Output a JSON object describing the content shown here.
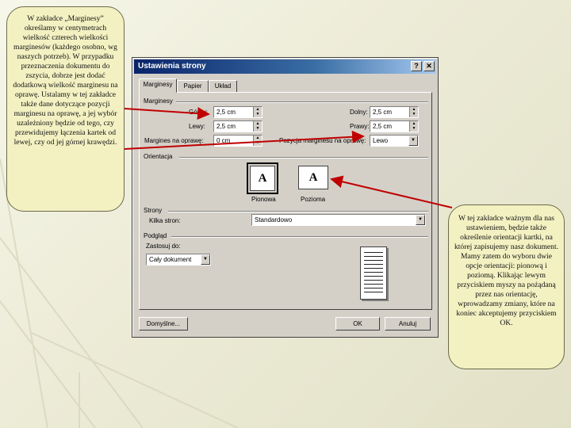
{
  "callout_left": {
    "text": "W zakładce „Marginesy” określamy w centymetrach wielkość czterech wielkości marginesów (każdego osobno, wg naszych potrzeb). W przypadku przeznaczenia dokumentu do zszycia, dobrze jest dodać dodatkową wielkość marginesu na oprawę. Ustalamy w tej zakładce także dane dotyczące pozycji marginesu na oprawę, a jej wybór uzależniony będzie od tego, czy przewidujemy łączenia kartek od lewej, czy od jej górnej krawędzi."
  },
  "callout_right": {
    "text": "W tej zakładce ważnym dla nas ustawieniem, będzie także określenie orientacji kartki, na której zapisujemy nasz dokument. Mamy zatem do wyboru dwie opcje orientacji: pionową i poziomą. Klikając lewym przyciskiem myszy na pożądaną przez nas orientację, wprowadzamy zmiany, które na koniec akceptujemy przyciskiem OK."
  },
  "dialog": {
    "title": "Ustawienia strony",
    "help_glyph": "?",
    "close_glyph": "✕",
    "tabs": [
      "Marginesy",
      "Papier",
      "Układ"
    ],
    "margins": {
      "group_label": "Marginesy",
      "top_label": "Górny:",
      "top_value": "2,5 cm",
      "bottom_label": "Dolny:",
      "bottom_value": "2,5 cm",
      "left_label": "Lewy:",
      "left_value": "2,5 cm",
      "right_label": "Prawy:",
      "right_value": "2,5 cm",
      "gutter_label": "Margines na oprawę:",
      "gutter_value": "0 cm",
      "gutter_pos_label": "Pozycja marginesu na oprawę:",
      "gutter_pos_value": "Lewo"
    },
    "orientation": {
      "group_label": "Orientacja",
      "portrait_label": "Pionowa",
      "landscape_label": "Pozioma",
      "glyph": "A"
    },
    "pages": {
      "group_label": "Strony",
      "multiple_label": "Kilka stron:",
      "multiple_value": "Standardowo"
    },
    "preview": {
      "group_label": "Podgląd",
      "apply_label": "Zastosuj do:",
      "apply_value": "Cały dokument"
    },
    "buttons": {
      "default": "Domyślne...",
      "ok": "OK",
      "cancel": "Anuluj"
    }
  }
}
